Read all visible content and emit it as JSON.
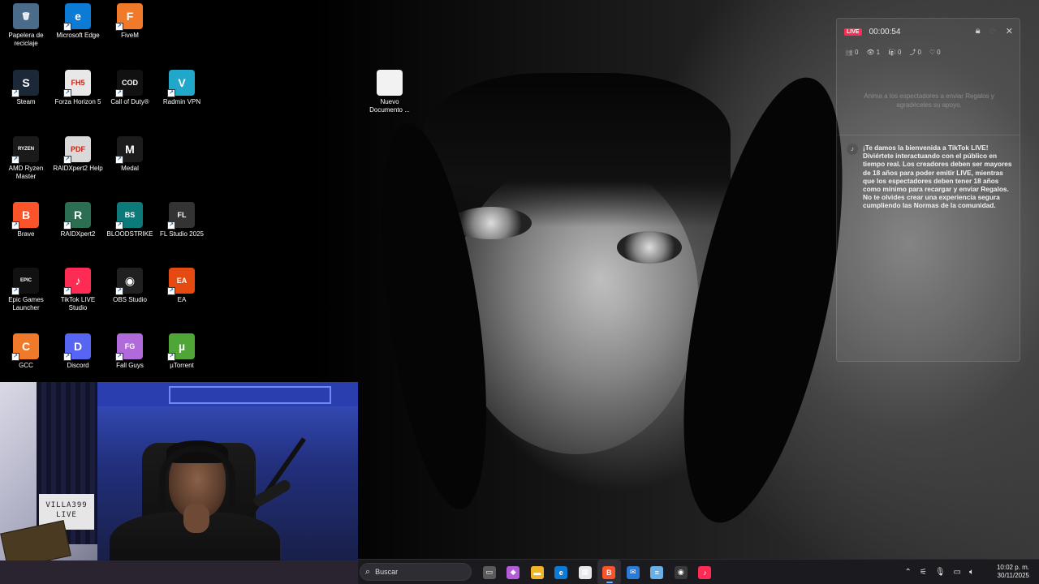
{
  "desktop": {
    "icons": [
      {
        "label": "Papelera de reciclaje",
        "icon": "recycle-bin-icon",
        "color": "#4a6b8a",
        "glyph": "🗑"
      },
      {
        "label": "Microsoft Edge",
        "icon": "edge-icon",
        "color": "#0c7bd6",
        "glyph": "e"
      },
      {
        "label": "FiveM",
        "icon": "fivem-icon",
        "color": "#f07a2a",
        "glyph": "F"
      },
      {
        "label": "Steam",
        "icon": "steam-icon",
        "color": "#1b2838",
        "glyph": "S"
      },
      {
        "label": "Forza Horizon 5",
        "icon": "forza-icon",
        "color": "#e8e8e8",
        "glyph": "FH5"
      },
      {
        "label": "Call of Duty®",
        "icon": "call-of-duty-icon",
        "color": "#111111",
        "glyph": "COD"
      },
      {
        "label": "Radmin VPN",
        "icon": "radmin-vpn-icon",
        "color": "#21a7c9",
        "glyph": "V"
      },
      {
        "label": "AMD Ryzen Master",
        "icon": "ryzen-master-icon",
        "color": "#1a1a1a",
        "glyph": "RYZEN"
      },
      {
        "label": "RAIDXpert2 Help",
        "icon": "pdf-icon",
        "color": "#d9d9d9",
        "glyph": "PDF"
      },
      {
        "label": "Medal",
        "icon": "medal-icon",
        "color": "#1c1c1c",
        "glyph": "M"
      },
      {
        "label": "Brave",
        "icon": "brave-icon",
        "color": "#fb542b",
        "glyph": "B"
      },
      {
        "label": "RAIDXpert2",
        "icon": "raidxpert-icon",
        "color": "#2c6e52",
        "glyph": "R"
      },
      {
        "label": "BLOODSTRIKE",
        "icon": "bloodstrike-icon",
        "color": "#0d7a7a",
        "glyph": "BS"
      },
      {
        "label": "FL Studio 2025",
        "icon": "fl-studio-icon",
        "color": "#333333",
        "glyph": "FL"
      },
      {
        "label": "Epic Games Launcher",
        "icon": "epic-games-icon",
        "color": "#111111",
        "glyph": "EPIC"
      },
      {
        "label": "TikTok LIVE Studio",
        "icon": "tiktok-live-studio-icon",
        "color": "#fe2c55",
        "glyph": "♪"
      },
      {
        "label": "OBS Studio",
        "icon": "obs-icon",
        "color": "#202020",
        "glyph": "◉"
      },
      {
        "label": "EA",
        "icon": "ea-icon",
        "color": "#e54a10",
        "glyph": "EA"
      },
      {
        "label": "GCC",
        "icon": "gcc-icon",
        "color": "#f07a2a",
        "glyph": "C"
      },
      {
        "label": "Discord",
        "icon": "discord-icon",
        "color": "#5865f2",
        "glyph": "D"
      },
      {
        "label": "Fall Guys",
        "icon": "fall-guys-icon",
        "color": "#b06ad9",
        "glyph": "FG"
      },
      {
        "label": "µTorrent",
        "icon": "utorrent-icon",
        "color": "#4fa636",
        "glyph": "µ"
      },
      {
        "label": "Nuevo Documento ...",
        "icon": "text-document-icon",
        "color": "#f2f2f2",
        "glyph": ""
      }
    ]
  },
  "live_panel": {
    "badge": "LIVE",
    "timer": "00:00:54",
    "stats": [
      {
        "icon": "people-icon",
        "glyph": "👥",
        "value": "0"
      },
      {
        "icon": "eye-icon",
        "glyph": "👁",
        "value": "1"
      },
      {
        "icon": "gift-icon",
        "glyph": "🎁",
        "value": "0"
      },
      {
        "icon": "share-icon",
        "glyph": "⤴",
        "value": "0"
      },
      {
        "icon": "heart-icon",
        "glyph": "♡",
        "value": "0"
      }
    ],
    "gift_hint": "Anima a los espectadores a enviar Regalos y agradéceles su apoyo.",
    "welcome_message": "¡Te damos la bienvenida a TikTok LIVE! Diviértete interactuando con el público en tiempo real. Los creadores deben ser mayores de 18 años para poder emitir LIVE, mientras que los espectadores deben tener 18 años como mínimo para recargar y enviar Regalos. No te olvides crear una experiencia segura cumpliendo las Normas de la comunidad."
  },
  "webcam": {
    "box_text_line1": "VILLA399",
    "box_text_line2": "LIVE"
  },
  "taskbar": {
    "search_placeholder": "Buscar",
    "apps": [
      {
        "name": "task-view-icon",
        "glyph": "▭",
        "color": "#5a5a5a"
      },
      {
        "name": "copilot-icon",
        "glyph": "◆",
        "color": "#b45cd9"
      },
      {
        "name": "file-explorer-icon",
        "glyph": "▬",
        "color": "#f2b52a"
      },
      {
        "name": "edge-icon",
        "glyph": "e",
        "color": "#0c7bd6"
      },
      {
        "name": "store-icon",
        "glyph": "▦",
        "color": "#e8e8e8"
      },
      {
        "name": "brave-icon",
        "glyph": "B",
        "color": "#fb542b"
      },
      {
        "name": "mail-icon",
        "glyph": "✉",
        "color": "#2a7ad9"
      },
      {
        "name": "notepad-icon",
        "glyph": "≡",
        "color": "#6ab0e6"
      },
      {
        "name": "obs-icon",
        "glyph": "◉",
        "color": "#3a3a3a"
      },
      {
        "name": "tiktok-live-studio-icon",
        "glyph": "♪",
        "color": "#fe2c55"
      }
    ],
    "active_app_index": 5,
    "clock_time": "10:02 p. m.",
    "clock_date": "30/11/2025"
  }
}
